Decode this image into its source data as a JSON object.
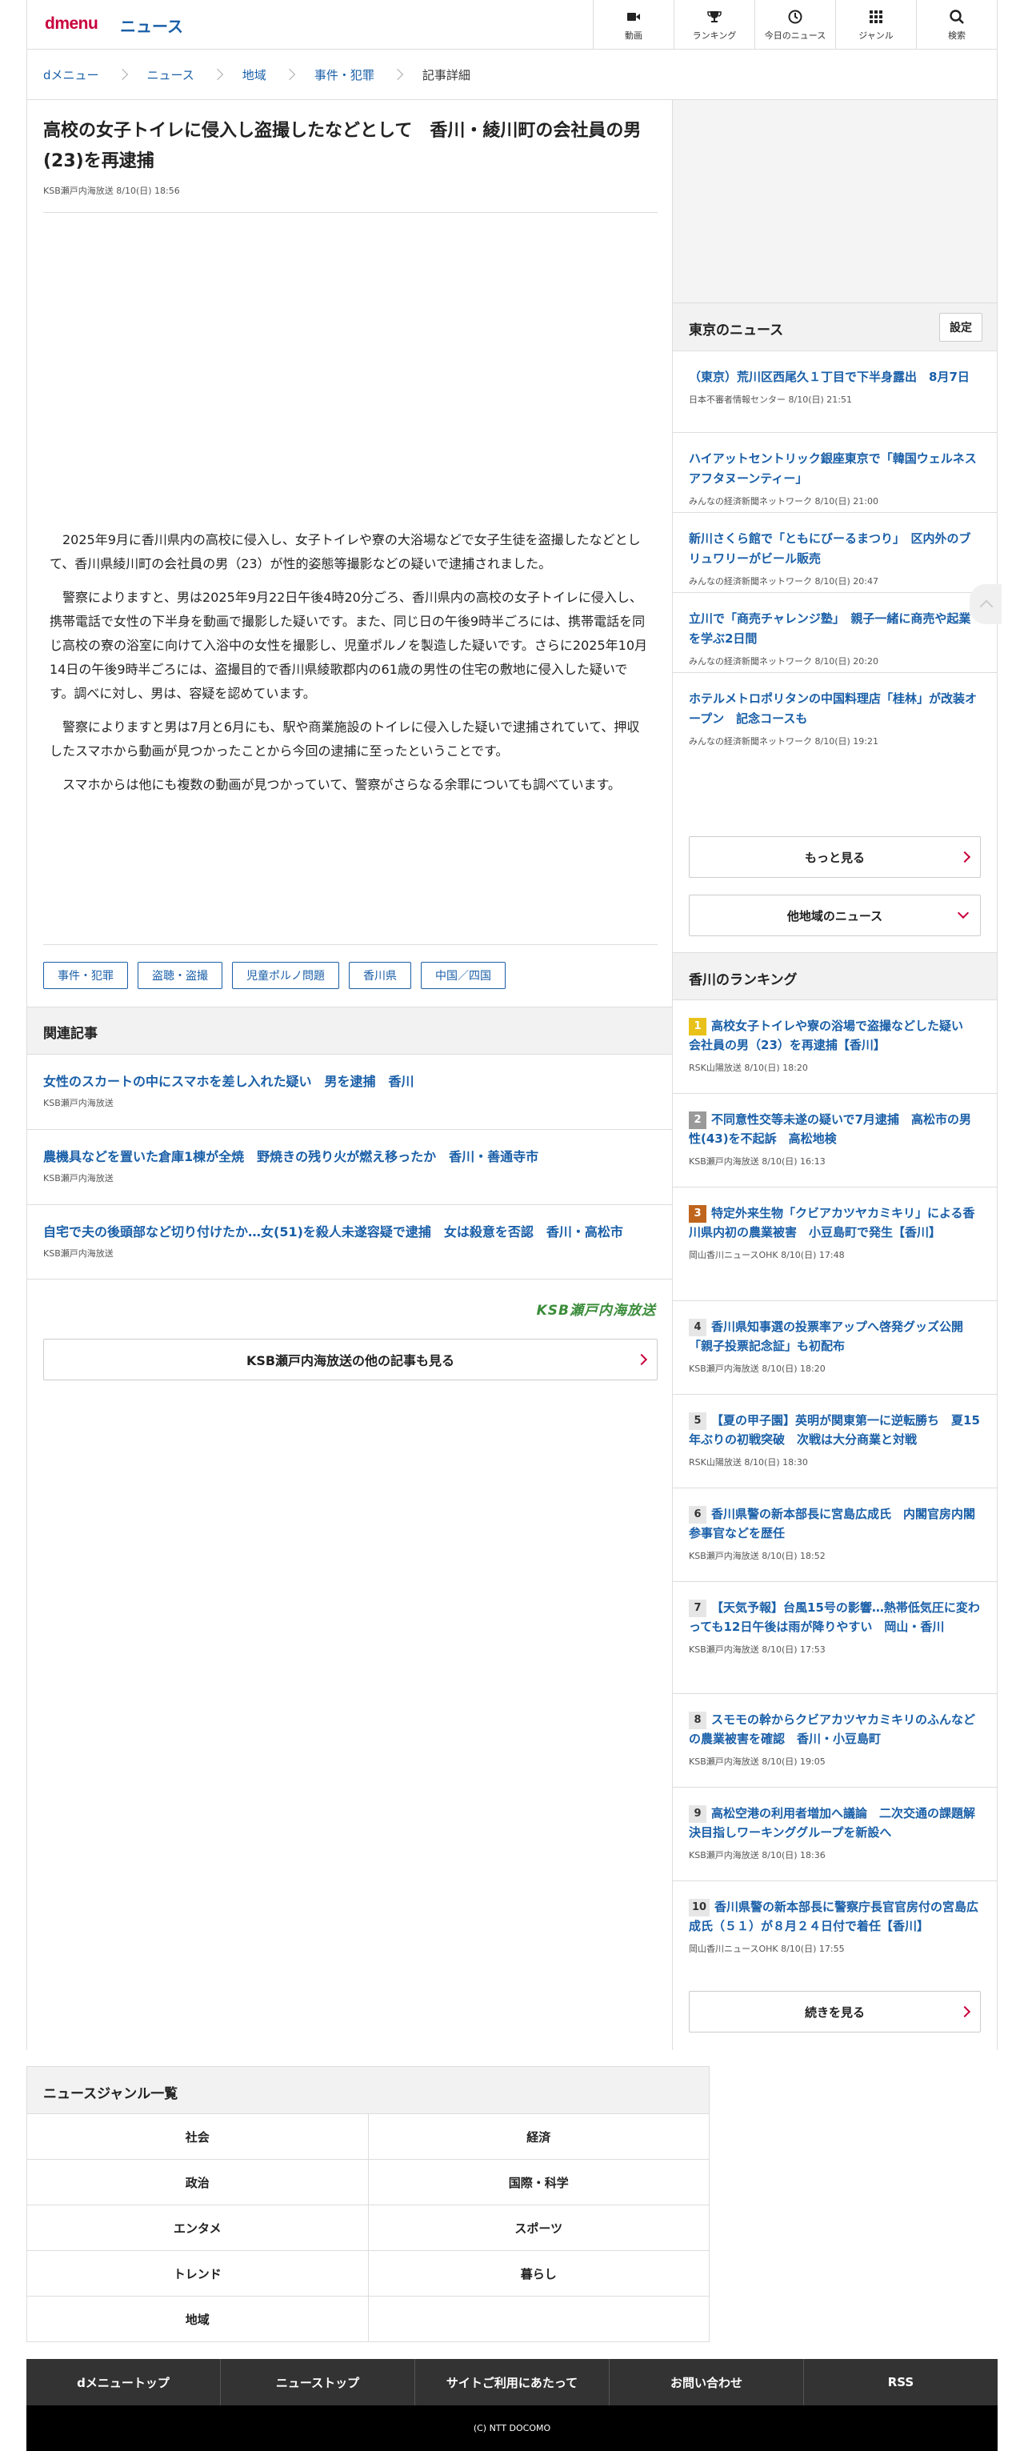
{
  "header": {
    "logo": "dmenu",
    "service": "ニュース",
    "nav": [
      {
        "icon": "video-icon",
        "label": "動画"
      },
      {
        "icon": "trophy-icon",
        "label": "ランキング"
      },
      {
        "icon": "clock-icon",
        "label": "今日のニュース"
      },
      {
        "icon": "grid-icon",
        "label": "ジャンル"
      },
      {
        "icon": "search-icon",
        "label": "検索"
      }
    ]
  },
  "breadcrumb": [
    "dメニュー",
    "ニュース",
    "地域",
    "事件・犯罪",
    "記事詳細"
  ],
  "article": {
    "title": "高校の女子トイレに侵入し盗撮したなどとして　香川・綾川町の会社員の男(23)を再逮捕",
    "meta": "KSB瀬戸内海放送 8/10(日) 18:56",
    "paragraphs": [
      "2025年9月に香川県内の高校に侵入し、女子トイレや寮の大浴場などで女子生徒を盗撮したなどとして、香川県綾川町の会社員の男（23）が性的姿態等撮影などの疑いで逮捕されました。",
      "警察によりますと、男は2025年9月22日午後4時20分ごろ、香川県内の高校の女子トイレに侵入し、携帯電話で女性の下半身を動画で撮影した疑いです。また、同じ日の午後9時半ごろには、携帯電話を同じ高校の寮の浴室に向けて入浴中の女性を撮影し、児童ポルノを製造した疑いです。さらに2025年10月14日の午後9時半ごろには、盗撮目的で香川県綾歌郡内の61歳の男性の住宅の敷地に侵入した疑いです。調べに対し、男は、容疑を認めています。",
      "警察によりますと男は7月と6月にも、駅や商業施設のトイレに侵入した疑いで逮捕されていて、押収したスマホから動画が見つかったことから今回の逮捕に至ったということです。",
      "スマホからは他にも複数の動画が見つかっていて、警察がさらなる余罪についても調べています。"
    ],
    "tags": [
      "事件・犯罪",
      "盗聴・盗撮",
      "児童ポルノ問題",
      "香川県",
      "中国／四国"
    ]
  },
  "related": {
    "heading": "関連記事",
    "items": [
      {
        "title": "女性のスカートの中にスマホを差し入れた疑い　男を逮捕　香川",
        "source": "KSB瀬戸内海放送"
      },
      {
        "title": "農機具などを置いた倉庫1棟が全焼　野焼きの残り火が燃え移ったか　香川・善通寺市",
        "source": "KSB瀬戸内海放送"
      },
      {
        "title": "自宅で夫の後頭部など切り付けたか…女(51)を殺人未遂容疑で逮捕　女は殺意を否認　香川・高松市",
        "source": "KSB瀬戸内海放送"
      }
    ]
  },
  "provider": {
    "logo_text": "KSB瀬戸内海放送",
    "more_label": "KSB瀬戸内海放送の他の記事も見る"
  },
  "tokyo": {
    "heading": "東京のニュース",
    "settings_label": "設定",
    "items": [
      {
        "title": "（東京）荒川区西尾久１丁目で下半身露出　8月7日",
        "source": "日本不審者情報センター 8/10(日) 21:51"
      },
      {
        "title": "ハイアットセントリック銀座東京で「韓国ウェルネス アフタヌーンティー」",
        "source": "みんなの経済新聞ネットワーク 8/10(日) 21:00"
      },
      {
        "title": "新川さくら館で「ともにびーるまつり」　区内外のブリュワリーがビール販売",
        "source": "みんなの経済新聞ネットワーク 8/10(日) 20:47"
      },
      {
        "title": "立川で「商売チャレンジ塾」　親子一緒に商売や起業を学ぶ2日間",
        "source": "みんなの経済新聞ネットワーク 8/10(日) 20:20"
      },
      {
        "title": "ホテルメトロポリタンの中国料理店「桂林」が改装オープン　記念コースも",
        "source": "みんなの経済新聞ネットワーク 8/10(日) 19:21"
      }
    ],
    "more_label": "もっと見る",
    "other_label": "他地域のニュース"
  },
  "ranking": {
    "heading": "香川のランキング",
    "items": [
      {
        "rank": "1",
        "title": "高校女子トイレや寮の浴場で盗撮などした疑い　会社員の男（23）を再逮捕【香川】",
        "source": "RSK山陽放送 8/10(日) 18:20"
      },
      {
        "rank": "2",
        "title": "不同意性交等未遂の疑いで7月逮捕　高松市の男性(43)を不起訴　高松地検",
        "source": "KSB瀬戸内海放送 8/10(日) 16:13"
      },
      {
        "rank": "3",
        "title": "特定外来生物「クビアカツヤカミキリ」による香川県内初の農業被害　小豆島町で発生【香川】",
        "source": "岡山香川ニュースOHK 8/10(日) 17:48"
      },
      {
        "rank": "4",
        "title": "香川県知事選の投票率アップへ啓発グッズ公開　「親子投票記念証」も初配布",
        "source": "KSB瀬戸内海放送 8/10(日) 18:20"
      },
      {
        "rank": "5",
        "title": "【夏の甲子園】英明が関東第一に逆転勝ち　夏15年ぶりの初戦突破　次戦は大分商業と対戦",
        "source": "RSK山陽放送 8/10(日) 18:30"
      },
      {
        "rank": "6",
        "title": "香川県警の新本部長に宮島広成氏　内閣官房内閣参事官などを歴任",
        "source": "KSB瀬戸内海放送 8/10(日) 18:52"
      },
      {
        "rank": "7",
        "title": "【天気予報】台風15号の影響…熱帯低気圧に変わっても12日午後は雨が降りやすい　岡山・香川",
        "source": "KSB瀬戸内海放送 8/10(日) 17:53"
      },
      {
        "rank": "8",
        "title": "スモモの幹からクビアカツヤカミキリのふんなどの農業被害を確認　香川・小豆島町",
        "source": "KSB瀬戸内海放送 8/10(日) 19:05"
      },
      {
        "rank": "9",
        "title": "高松空港の利用者増加へ議論　二次交通の課題解決目指しワーキンググループを新設へ",
        "source": "KSB瀬戸内海放送 8/10(日) 18:36"
      },
      {
        "rank": "10",
        "title": "香川県警の新本部長に警察庁長官官房付の宮島広成氏（５１）が８月２４日付で着任【香川】",
        "source": "岡山香川ニュースOHK 8/10(日) 17:55"
      }
    ],
    "more_label": "続きを見る"
  },
  "genres": {
    "heading": "ニュースジャンル一覧",
    "items": [
      "社会",
      "経済",
      "政治",
      "国際・科学",
      "エンタメ",
      "スポーツ",
      "トレンド",
      "暮らし",
      "地域",
      ""
    ]
  },
  "footer": {
    "links": [
      "dメニュートップ",
      "ニューストップ",
      "サイトご利用にあたって",
      "お問い合わせ",
      "RSS"
    ],
    "copyright": "(C) NTT DOCOMO"
  },
  "colors": {
    "brand": "#c8003c",
    "link": "#1a5fa8",
    "footer": "#333333"
  }
}
